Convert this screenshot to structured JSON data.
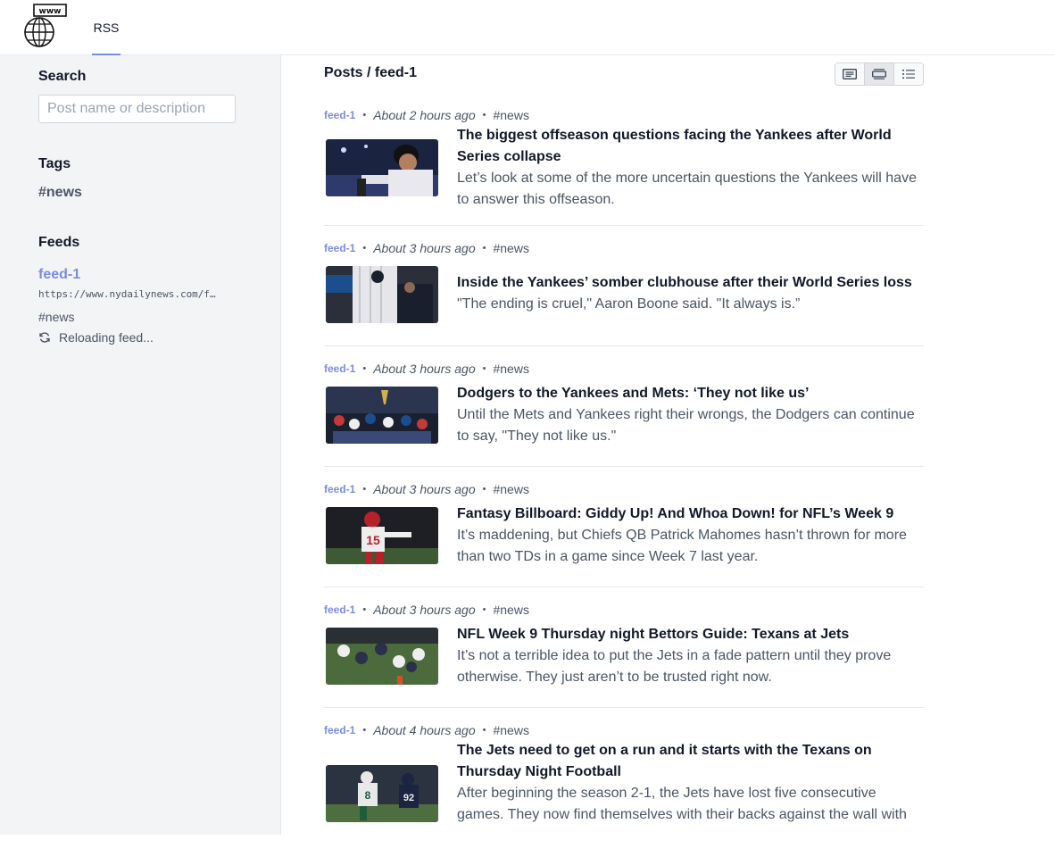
{
  "nav": {
    "tab_label": "RSS",
    "logo_text": "www"
  },
  "sidebar": {
    "search_heading": "Search",
    "search_placeholder": "Post name or description",
    "search_value": "",
    "tags_heading": "Tags",
    "tags": [
      "#news"
    ],
    "feeds_heading": "Feeds",
    "feed": {
      "name": "feed-1",
      "url": "https://www.nydailynews.com/f…",
      "tag": "#news",
      "status": "Reloading feed..."
    }
  },
  "main": {
    "title": "Posts / feed-1",
    "view_modes": [
      "text-view-icon",
      "card-view-icon",
      "list-view-icon"
    ],
    "active_view": "card-view-icon",
    "posts": [
      {
        "source": "feed-1",
        "time": "About 2 hours ago",
        "tag": "#news",
        "title": "The biggest offseason questions facing the Yankees after World Series collapse",
        "description": "Let’s look at some of the more uncertain questions the Yankees will have to answer this offseason."
      },
      {
        "source": "feed-1",
        "time": "About 3 hours ago",
        "tag": "#news",
        "title": "Inside the Yankees’ somber clubhouse after their World Series loss",
        "description": "\"The ending is cruel,\" Aaron Boone said. \"It always is.”"
      },
      {
        "source": "feed-1",
        "time": "About 3 hours ago",
        "tag": "#news",
        "title": "Dodgers to the Yankees and Mets: ‘They not like us’",
        "description": "Until the Mets and Yankees right their wrongs, the Dodgers can continue to say, \"They not like us.\""
      },
      {
        "source": "feed-1",
        "time": "About 3 hours ago",
        "tag": "#news",
        "title": "Fantasy Billboard: Giddy Up! And Whoa Down! for NFL’s Week 9",
        "description": "It’s maddening, but Chiefs QB Patrick Mahomes hasn’t thrown for more than two TDs in a game since Week 7 last year."
      },
      {
        "source": "feed-1",
        "time": "About 3 hours ago",
        "tag": "#news",
        "title": "NFL Week 9 Thursday night Bettors Guide: Texans at Jets",
        "description": "It’s not a terrible idea to put the Jets in a fade pattern until they prove otherwise. They just aren’t to be trusted right now."
      },
      {
        "source": "feed-1",
        "time": "About 4 hours ago",
        "tag": "#news",
        "title": "The Jets need to get on a run and it starts with the Texans on Thursday Night Football",
        "description": "After beginning the season 2-1, the Jets have lost five consecutive games. They now find themselves with their backs against the wall with"
      }
    ]
  },
  "colors": {
    "accent": "#7c8ce0",
    "sidebar_bg": "#f3f4f6",
    "border": "#e5e7eb"
  }
}
